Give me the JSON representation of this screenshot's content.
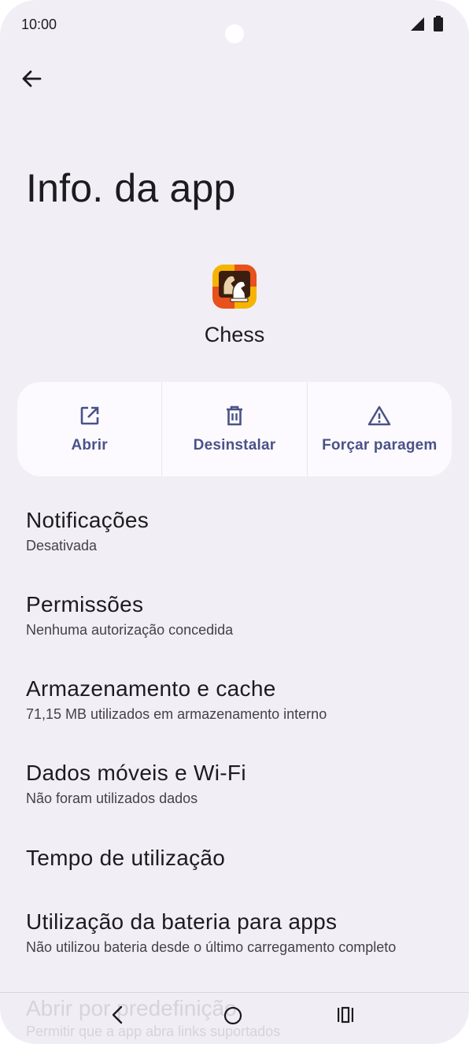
{
  "status_bar": {
    "time": "10:00",
    "icons": [
      "signal-icon",
      "battery-icon"
    ]
  },
  "header": {
    "title": "Info. da app",
    "back_icon": "arrow-left-icon"
  },
  "app": {
    "name": "Chess",
    "icon": "chess-app-icon"
  },
  "actions": [
    {
      "label": "Abrir",
      "icon": "open-external-icon"
    },
    {
      "label": "Desinstalar",
      "icon": "trash-icon"
    },
    {
      "label": "Forçar paragem",
      "icon": "warning-icon"
    }
  ],
  "settings": [
    {
      "title": "Notificações",
      "subtitle": "Desativada"
    },
    {
      "title": "Permissões",
      "subtitle": "Nenhuma autorização concedida"
    },
    {
      "title": "Armazenamento e cache",
      "subtitle": "71,15 MB utilizados em armazenamento interno"
    },
    {
      "title": "Dados móveis e Wi-Fi",
      "subtitle": "Não foram utilizados dados"
    },
    {
      "title": "Tempo de utilização",
      "subtitle": ""
    },
    {
      "title": "Utilização da bateria para apps",
      "subtitle": "Não utilizou bateria desde o último carregamento completo"
    },
    {
      "title": "Abrir por predefinição",
      "subtitle": "Permitir que a app abra links suportados"
    }
  ],
  "nav_bar": {
    "icons": [
      "nav-back-icon",
      "nav-home-icon",
      "nav-recents-icon"
    ]
  },
  "colors": {
    "background": "#f1eef5",
    "card": "#fcfaff",
    "accent": "#4a5287",
    "text": "#1c1b1f"
  }
}
